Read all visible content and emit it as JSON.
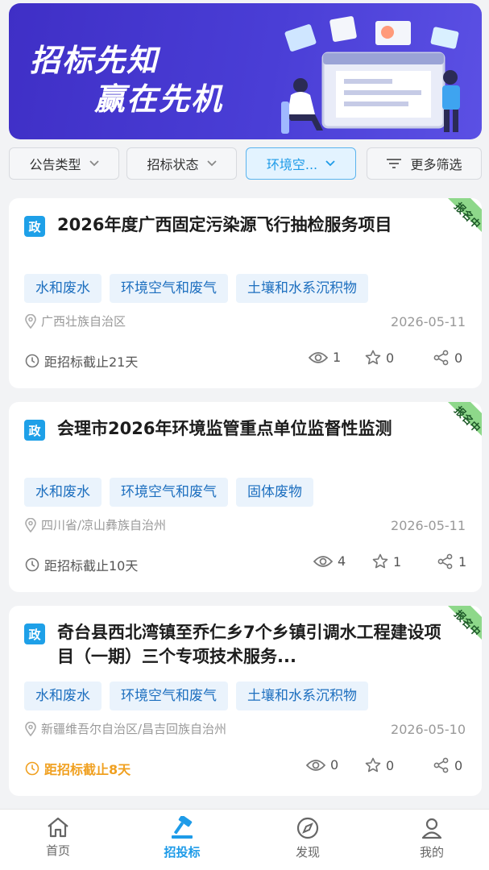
{
  "banner": {
    "line1": "招标先知",
    "line2": "赢在先机"
  },
  "filters": [
    {
      "label": "公告类型",
      "icon": "chevron-down-icon"
    },
    {
      "label": "招标状态",
      "icon": "chevron-down-icon"
    },
    {
      "label": "环境空...",
      "icon": "chevron-down-icon",
      "active": true
    },
    {
      "label": "更多筛选",
      "icon": "filter-icon"
    }
  ],
  "cards": [
    {
      "badge": "政",
      "title": "2026年度广西固定污染源飞行抽检服务项目",
      "status": "报名中",
      "tags": [
        "水和废水",
        "环境空气和废气",
        "土壤和水系沉积物"
      ],
      "location": "广西壮族自治区",
      "date": "2026-05-11",
      "deadline": "距招标截止21天",
      "views": "1",
      "stars": "0",
      "shares": "0"
    },
    {
      "badge": "政",
      "title": "会理市2026年环境监管重点单位监督性监测",
      "status": "报名中",
      "tags": [
        "水和废水",
        "环境空气和废气",
        "固体废物"
      ],
      "location": "四川省/凉山彝族自治州",
      "date": "2026-05-11",
      "deadline": "距招标截止10天",
      "views": "4",
      "stars": "1",
      "shares": "1"
    },
    {
      "badge": "政",
      "title": "奇台县西北湾镇至乔仁乡7个乡镇引调水工程建设项目（一期）三个专项技术服务...",
      "status": "报名中",
      "tags": [
        "水和废水",
        "环境空气和废气",
        "土壤和水系沉积物"
      ],
      "location": "新疆维吾尔自治区/昌吉回族自治州",
      "date": "2026-05-10",
      "deadline": "距招标截止8天",
      "views": "0",
      "stars": "0",
      "shares": "0"
    }
  ],
  "tabbar": [
    {
      "label": "首页",
      "icon": "home-icon"
    },
    {
      "label": "招投标",
      "icon": "gavel-icon",
      "active": true
    },
    {
      "label": "发现",
      "icon": "compass-icon"
    },
    {
      "label": "我的",
      "icon": "user-icon"
    }
  ],
  "colors": {
    "accent": "#1e9be8",
    "warn": "#f0a020",
    "ribbon": "#8ed88a",
    "banner": "#4a3ed6"
  }
}
